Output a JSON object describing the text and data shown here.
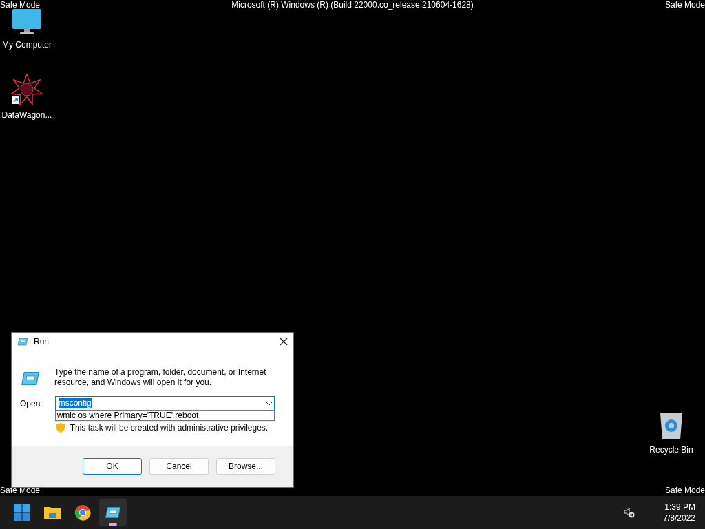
{
  "desktop": {
    "build_title": "Microsoft (R) Windows (R) (Build 22000.co_release.210604-1628)",
    "corner_labels": [
      "Safe Mode",
      "Safe Mode",
      "Safe Mode",
      "Safe Mode"
    ],
    "icons": [
      {
        "kind": "computer",
        "label": "My Computer"
      },
      {
        "kind": "shortcut",
        "label": "DataWagon..."
      },
      {
        "kind": "recycle",
        "label": "Recycle Bin"
      }
    ]
  },
  "run_dialog": {
    "title": "Run",
    "description": "Type the name of a program, folder, document, or Internet resource, and Windows will open it for you.",
    "open_label": "Open:",
    "value": "msconfig",
    "value_selected": true,
    "suggestion": "wmic os where Primary='TRUE' reboot",
    "admin_note": "This task will be created with administrative privileges.",
    "buttons": [
      "OK",
      "Cancel",
      "Browse..."
    ]
  },
  "taskbar": {
    "apps": [
      {
        "kind": "start",
        "selected": false
      },
      {
        "kind": "explorer",
        "selected": false
      },
      {
        "kind": "chrome",
        "selected": false
      },
      {
        "kind": "run",
        "selected": true
      }
    ],
    "time": "1:39 PM",
    "date": "7/8/2022"
  }
}
